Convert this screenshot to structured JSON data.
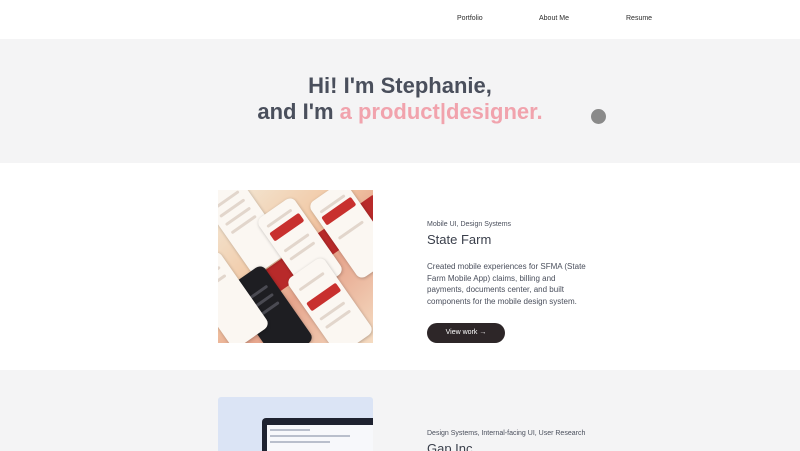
{
  "nav": {
    "items": [
      {
        "label": "Portfolio"
      },
      {
        "label": "About Me"
      },
      {
        "label": "Resume"
      }
    ]
  },
  "hero": {
    "line1": "Hi! I'm Stephanie,",
    "line2_prefix": "and I'm ",
    "line2_accent": "a product|designer.",
    "accent_color": "#f1a3ad"
  },
  "projects": [
    {
      "tags": "Mobile UI, Design Systems",
      "title": "State Farm",
      "description": "Created mobile experiences for SFMA (State Farm Mobile App) claims, billing and payments, documents center, and built components for the mobile design system.",
      "cta": "View work →"
    },
    {
      "tags": "Design Systems, Internal-facing UI, User Research",
      "title": "Gap Inc"
    }
  ],
  "colors": {
    "button_bg": "#2d2628",
    "hero_bg": "#f4f4f5",
    "text": "#3a3f4b"
  }
}
